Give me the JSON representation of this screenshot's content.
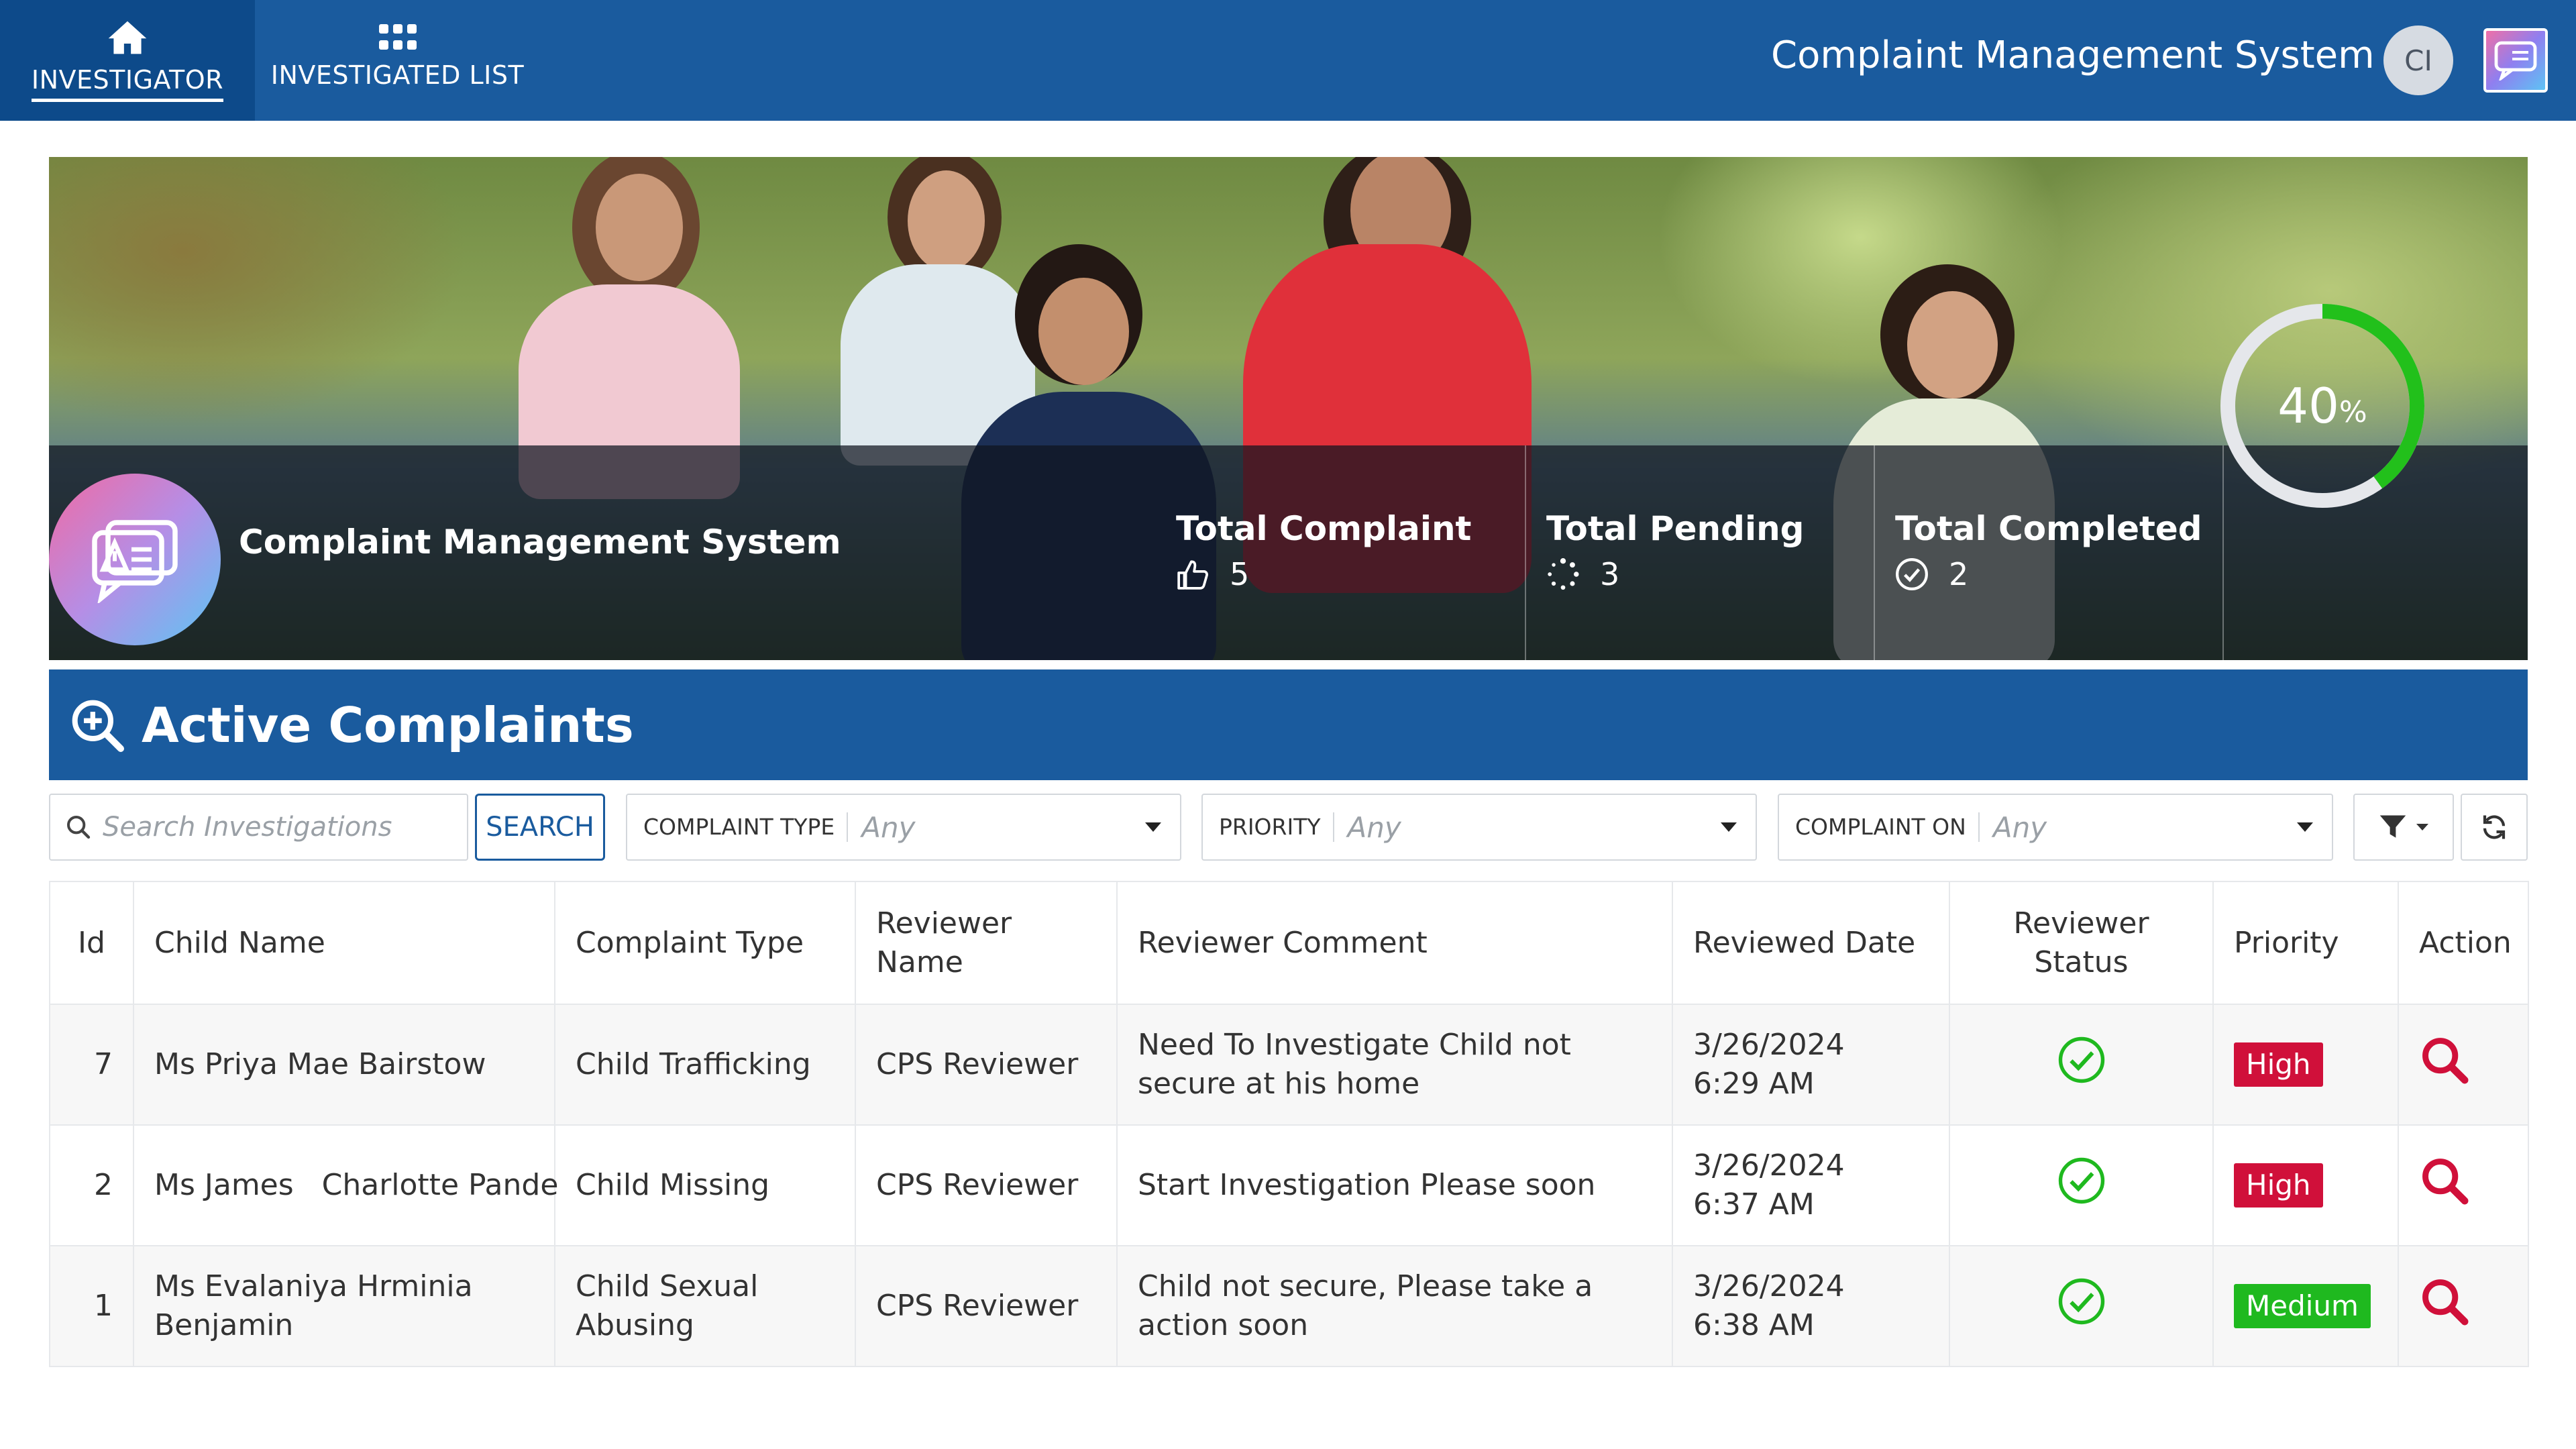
{
  "nav": {
    "tabs": [
      {
        "label": "INVESTIGATOR",
        "icon": "home-icon",
        "active": true
      },
      {
        "label": "INVESTIGATED LIST",
        "icon": "grid-icon",
        "active": false
      }
    ],
    "app_title": "Complaint Management System",
    "avatar_initials": "CI",
    "logo_icon": "complaint-chat-icon"
  },
  "hero": {
    "title": "Complaint Management System",
    "stats": [
      {
        "label": "Total Complaint",
        "value": "5",
        "icon": "thumbs-up-icon"
      },
      {
        "label": "Total Pending",
        "value": "3",
        "icon": "spinner-icon"
      },
      {
        "label": "Total Completed",
        "value": "2",
        "icon": "check-circle-icon"
      }
    ],
    "progress": {
      "value": "40",
      "unit": "%",
      "fraction": 0.4,
      "track_color": "#e5e7eb",
      "fill_color": "#22c01b"
    }
  },
  "section": {
    "title": "Active Complaints",
    "icon": "zoom-search-icon"
  },
  "filters": {
    "search_placeholder": "Search Investigations",
    "search_button": "SEARCH",
    "items": [
      {
        "label": "COMPLAINT TYPE",
        "value": "Any"
      },
      {
        "label": "PRIORITY",
        "value": "Any"
      },
      {
        "label": "COMPLAINT ON",
        "value": "Any"
      }
    ]
  },
  "table": {
    "columns": [
      "Id",
      "Child Name",
      "Complaint Type",
      "Reviewer Name",
      "Reviewer Comment",
      "Reviewed Date",
      "Reviewer Status",
      "Priority",
      "Action"
    ],
    "rows": [
      {
        "id": "7",
        "child_name": "Ms Priya Mae Bairstow",
        "complaint_type": "Child Trafficking",
        "reviewer_name": "CPS Reviewer",
        "comment": "Need To Investigate Child not secure at his home",
        "date": "3/26/2024 6:29 AM",
        "status_icon": "check-circle-icon",
        "priority": "High",
        "action_icon": "search-icon"
      },
      {
        "id": "2",
        "child_name": "Ms James   Charlotte Pande",
        "complaint_type": "Child Missing",
        "reviewer_name": "CPS Reviewer",
        "comment": "Start Investigation Please soon",
        "date": "3/26/2024 6:37 AM",
        "status_icon": "check-circle-icon",
        "priority": "High",
        "action_icon": "search-icon"
      },
      {
        "id": "1",
        "child_name": "Ms Evalaniya Hrminia Benjamin",
        "complaint_type": "Child Sexual Abusing",
        "reviewer_name": "CPS Reviewer",
        "comment": "Child not secure, Please take a action soon",
        "date": "3/26/2024 6:38 AM",
        "status_icon": "check-circle-icon",
        "priority": "Medium",
        "action_icon": "search-icon"
      }
    ]
  },
  "colors": {
    "brand": "#1a5b9e",
    "high": "#d0103a",
    "medium": "#1fb91f",
    "status_ok": "#1fb91f",
    "action": "#d0103a"
  }
}
